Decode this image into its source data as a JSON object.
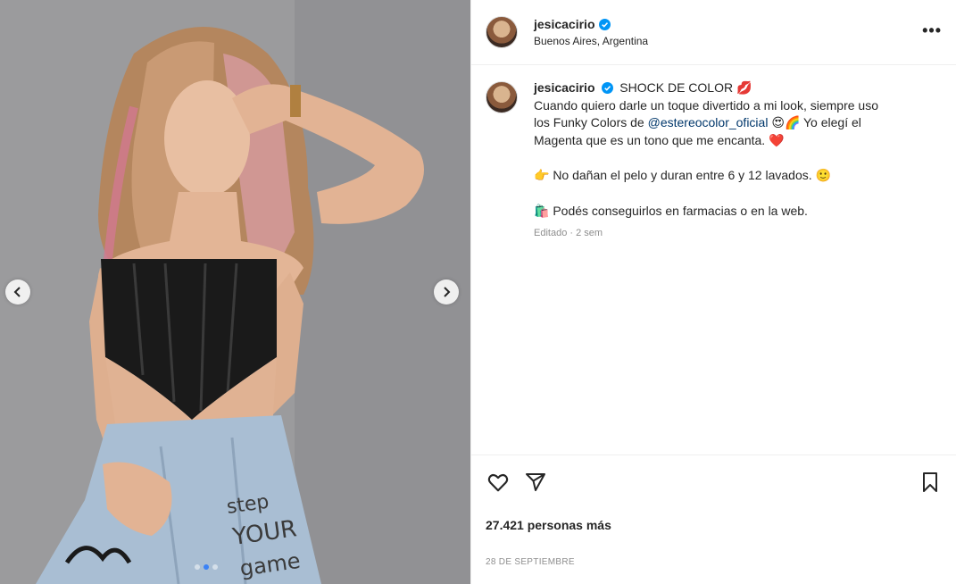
{
  "post": {
    "username": "jesicacirio",
    "location": "Buenos Aires, Argentina",
    "more_label": "•••",
    "caption": {
      "title": "SHOCK DE COLOR 💋",
      "line1": "Cuando quiero darle un toque divertido a mi look, siempre uso",
      "line2_pre": "los Funky Colors de ",
      "mention": "@estereocolor_oficial",
      "line2_post": " 😍🌈 Yo elegí el",
      "line3": "Magenta que es un tono que me encanta. ❤️",
      "line4": "👉 No dañan el pelo y duran entre 6 y 12 lavados. 🙂",
      "line5": "🛍️ Podés conseguirlos en farmacias o en la web."
    },
    "edited_meta": "Editado · 2 sem",
    "likes": "27.421 personas más",
    "date": "28 DE SEPTIEMBRE"
  },
  "media": {
    "carousel_count": 3,
    "active_index": 1,
    "accent_color": "#3b82f6"
  },
  "icons": {
    "verified": "verified-badge-icon",
    "like": "heart-icon",
    "share": "paper-plane-icon",
    "save": "bookmark-icon",
    "prev": "chevron-left-icon",
    "next": "chevron-right-icon"
  },
  "colors": {
    "verified": "#0095f6",
    "mention": "#00376b",
    "muted": "#8e8e8e"
  }
}
